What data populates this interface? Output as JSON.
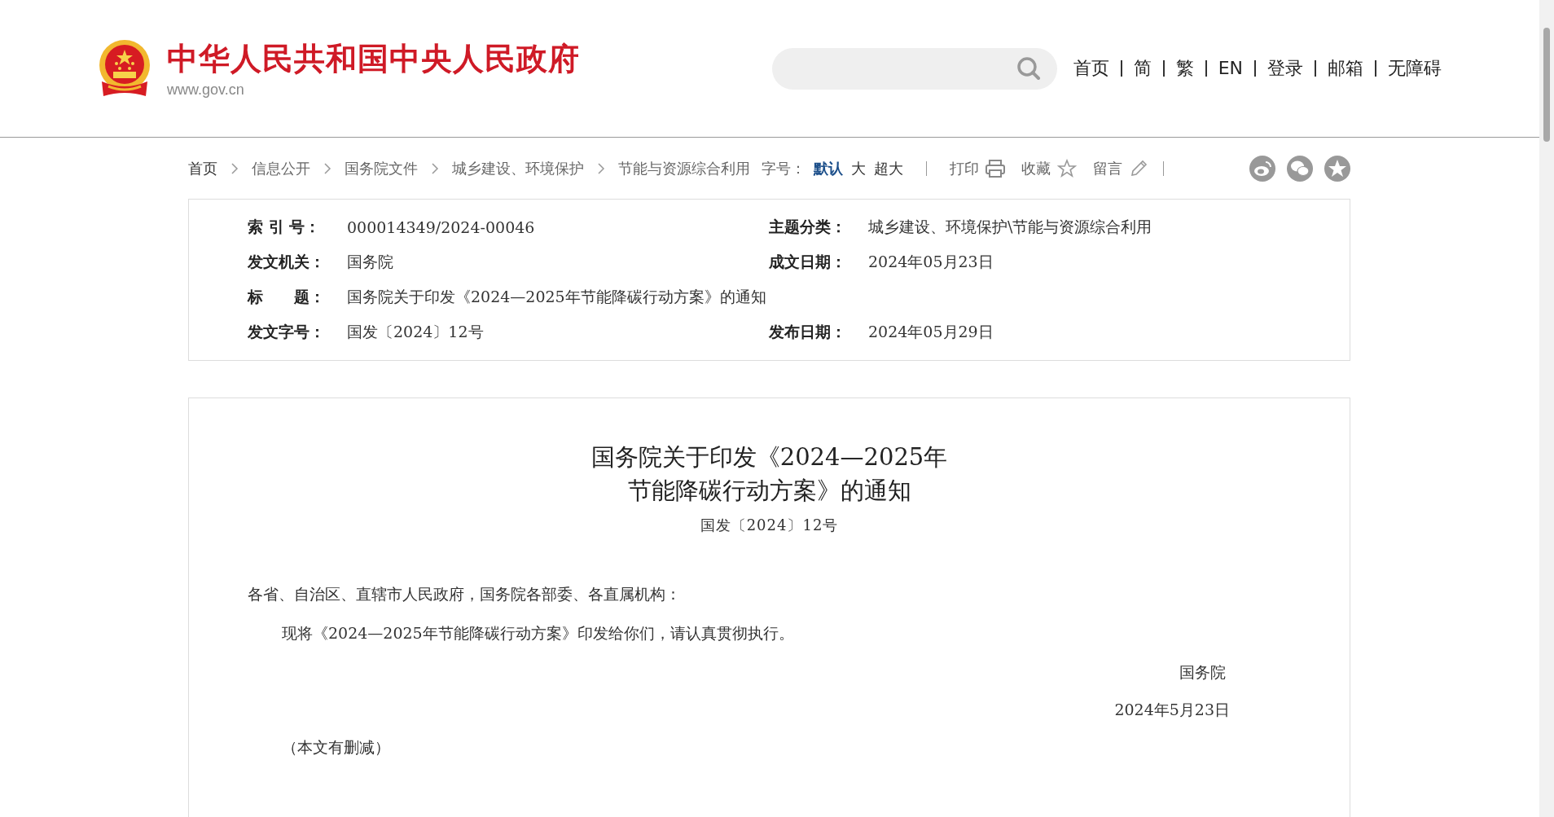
{
  "header": {
    "site_title": "中华人民共和国中央人民政府",
    "site_url": "www.gov.cn",
    "nav_links": [
      "首页",
      "简",
      "繁",
      "EN",
      "登录",
      "邮箱",
      "无障碍"
    ]
  },
  "breadcrumb": [
    "首页",
    "信息公开",
    "国务院文件",
    "城乡建设、环境保护",
    "节能与资源综合利用"
  ],
  "font_size": {
    "label": "字号：",
    "options": [
      {
        "label": "默认",
        "selected": true
      },
      {
        "label": "大",
        "selected": false
      },
      {
        "label": "超大",
        "selected": false
      }
    ]
  },
  "tools": [
    {
      "label": "打印",
      "kind": "print"
    },
    {
      "label": "收藏",
      "kind": "favorite"
    },
    {
      "label": "留言",
      "kind": "comment"
    }
  ],
  "share": [
    {
      "kind": "swirl"
    },
    {
      "kind": "bubbles"
    },
    {
      "kind": "star"
    }
  ],
  "info": [
    [
      {
        "label": "索 引 号：",
        "value": "000014349/2024-00046"
      },
      {
        "label": "主题分类：",
        "value": "城乡建设、环境保护\\节能与资源综合利用"
      }
    ],
    [
      {
        "label": "发文机关：",
        "value": "国务院"
      },
      {
        "label": "成文日期：",
        "value": "2024年05月23日"
      }
    ],
    [
      {
        "label": "标　　题：",
        "value": "国务院关于印发《2024—2025年节能降碳行动方案》的通知"
      }
    ],
    [
      {
        "label": "发文字号：",
        "value": "国发〔2024〕12号"
      },
      {
        "label": "发布日期：",
        "value": "2024年05月29日"
      }
    ]
  ],
  "document": {
    "title_lines": [
      "国务院关于印发《2024—2025年",
      "节能降碳行动方案》的通知"
    ],
    "doc_number": "国发〔2024〕12号",
    "salutation": "各省、自治区、直辖市人民政府，国务院各部委、各直属机构：",
    "paragraphs": [
      "现将《2024—2025年节能降碳行动方案》印发给你们，请认真贯彻执行。"
    ],
    "signature": "国务院",
    "date": "2024年5月23日",
    "note": "（本文有删减）"
  }
}
